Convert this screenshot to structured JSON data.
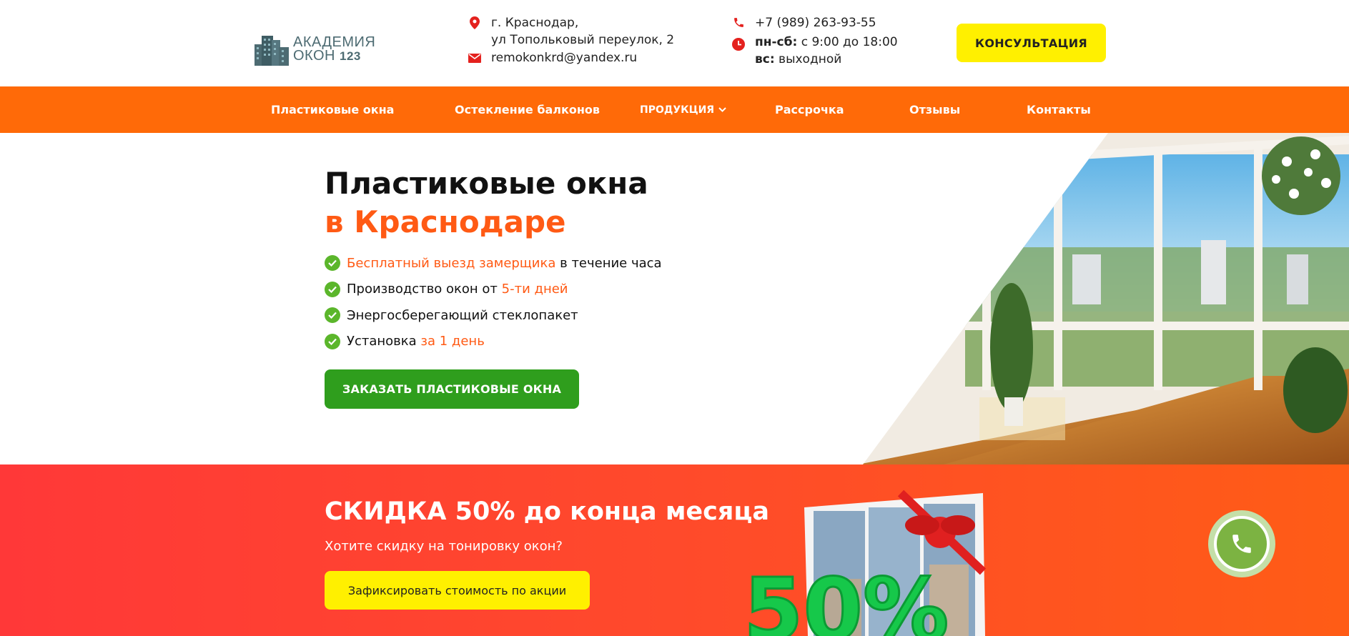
{
  "header": {
    "logo": {
      "line1": "АКАДЕМИЯ",
      "line2": "ОКОН",
      "number": "123"
    },
    "address": {
      "line1": "г. Краснодар,",
      "line2": "ул Топольковый переулок, 2"
    },
    "email": "remokonkrd@yandex.ru",
    "phone": "+7 (989) 263-93-55",
    "hours": {
      "weekdays_label": "пн-сб:",
      "weekdays_value": "с 9:00 до 18:00",
      "sunday_label": "вс:",
      "sunday_value": "выходной"
    },
    "consult_button": "КОНСУЛЬТАЦИЯ"
  },
  "nav": {
    "items": [
      {
        "label": "Пластиковые окна"
      },
      {
        "label": "Остекление балконов"
      },
      {
        "label": "ПРОДУКЦИЯ"
      },
      {
        "label": "Рассрочка"
      },
      {
        "label": "Отзывы"
      },
      {
        "label": "Контакты"
      }
    ]
  },
  "hero": {
    "title_line1": "Пластиковые окна",
    "title_line2": "в Краснодаре",
    "features": [
      {
        "accent": "Бесплатный выезд замерщика",
        "text": " в течение часа"
      },
      {
        "text": "Производство окон от ",
        "accent": "5-ти дней"
      },
      {
        "text": "Энергосберегающий стеклопакет"
      },
      {
        "text": "Установка ",
        "accent": "за 1 день"
      }
    ],
    "order_button": "ЗАКАЗАТЬ ПЛАСТИКОВЫЕ ОКНА"
  },
  "promo": {
    "title": "СКИДКА 50% до конца месяца",
    "subtitle": "Хотите скидку на тонировку окон?",
    "button": "Зафиксировать стоимость по акции",
    "badge": "50%"
  },
  "colors": {
    "brand_orange": "#ff6a08",
    "accent_orange": "#ff5a14",
    "cta_yellow": "#fff000",
    "cta_green": "#2f9e1d",
    "check_green": "#5bb62b",
    "icon_red": "#e4211e"
  },
  "icons": {
    "address": "map-pin-icon",
    "email": "envelope-icon",
    "phone": "phone-icon",
    "hours": "clock-icon",
    "dropdown": "chevron-down-icon",
    "feature": "check-circle-icon",
    "call": "phone-call-icon"
  }
}
